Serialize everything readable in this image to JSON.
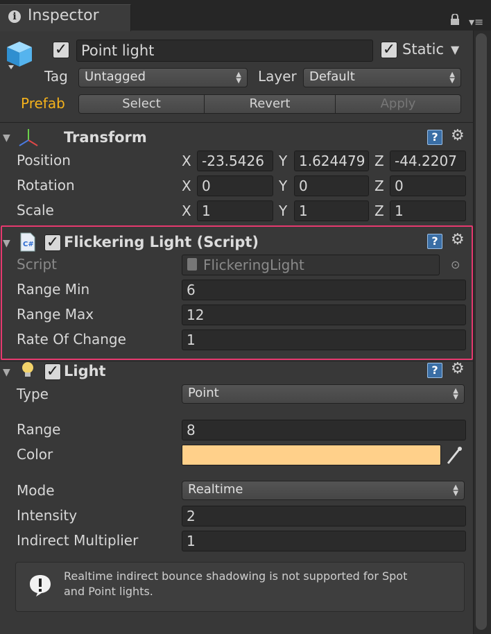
{
  "tab": {
    "title": "Inspector"
  },
  "header": {
    "object_name": "Point light",
    "active": true,
    "static_label": "Static",
    "static_checked": true,
    "tag_label": "Tag",
    "tag_value": "Untagged",
    "layer_label": "Layer",
    "layer_value": "Default",
    "prefab_label": "Prefab",
    "prefab_select": "Select",
    "prefab_revert": "Revert",
    "prefab_apply": "Apply"
  },
  "transform": {
    "title": "Transform",
    "position_label": "Position",
    "rotation_label": "Rotation",
    "scale_label": "Scale",
    "axes": {
      "x": "X",
      "y": "Y",
      "z": "Z"
    },
    "position": {
      "x": "-23.5426",
      "y": "1.624479",
      "z": "-44.2207"
    },
    "rotation": {
      "x": "0",
      "y": "0",
      "z": "0"
    },
    "scale": {
      "x": "1",
      "y": "1",
      "z": "1"
    }
  },
  "flicker": {
    "title": "Flickering Light (Script)",
    "enabled": true,
    "script_label": "Script",
    "script_value": "FlickeringLight",
    "range_min_label": "Range Min",
    "range_min": "6",
    "range_max_label": "Range Max",
    "range_max": "12",
    "rate_label": "Rate Of Change",
    "rate": "1"
  },
  "light": {
    "title": "Light",
    "enabled": true,
    "type_label": "Type",
    "type_value": "Point",
    "range_label": "Range",
    "range": "8",
    "color_label": "Color",
    "color_hex": "#ffd08a",
    "mode_label": "Mode",
    "mode_value": "Realtime",
    "intensity_label": "Intensity",
    "intensity": "2",
    "indirect_label": "Indirect Multiplier",
    "indirect": "1",
    "info_text_1": "Realtime indirect bounce shadowing is not supported for Spot",
    "info_text_2": "and Point lights."
  },
  "colors": {
    "accent_prefab": "#f5b21b",
    "highlight": "#e6396f"
  }
}
